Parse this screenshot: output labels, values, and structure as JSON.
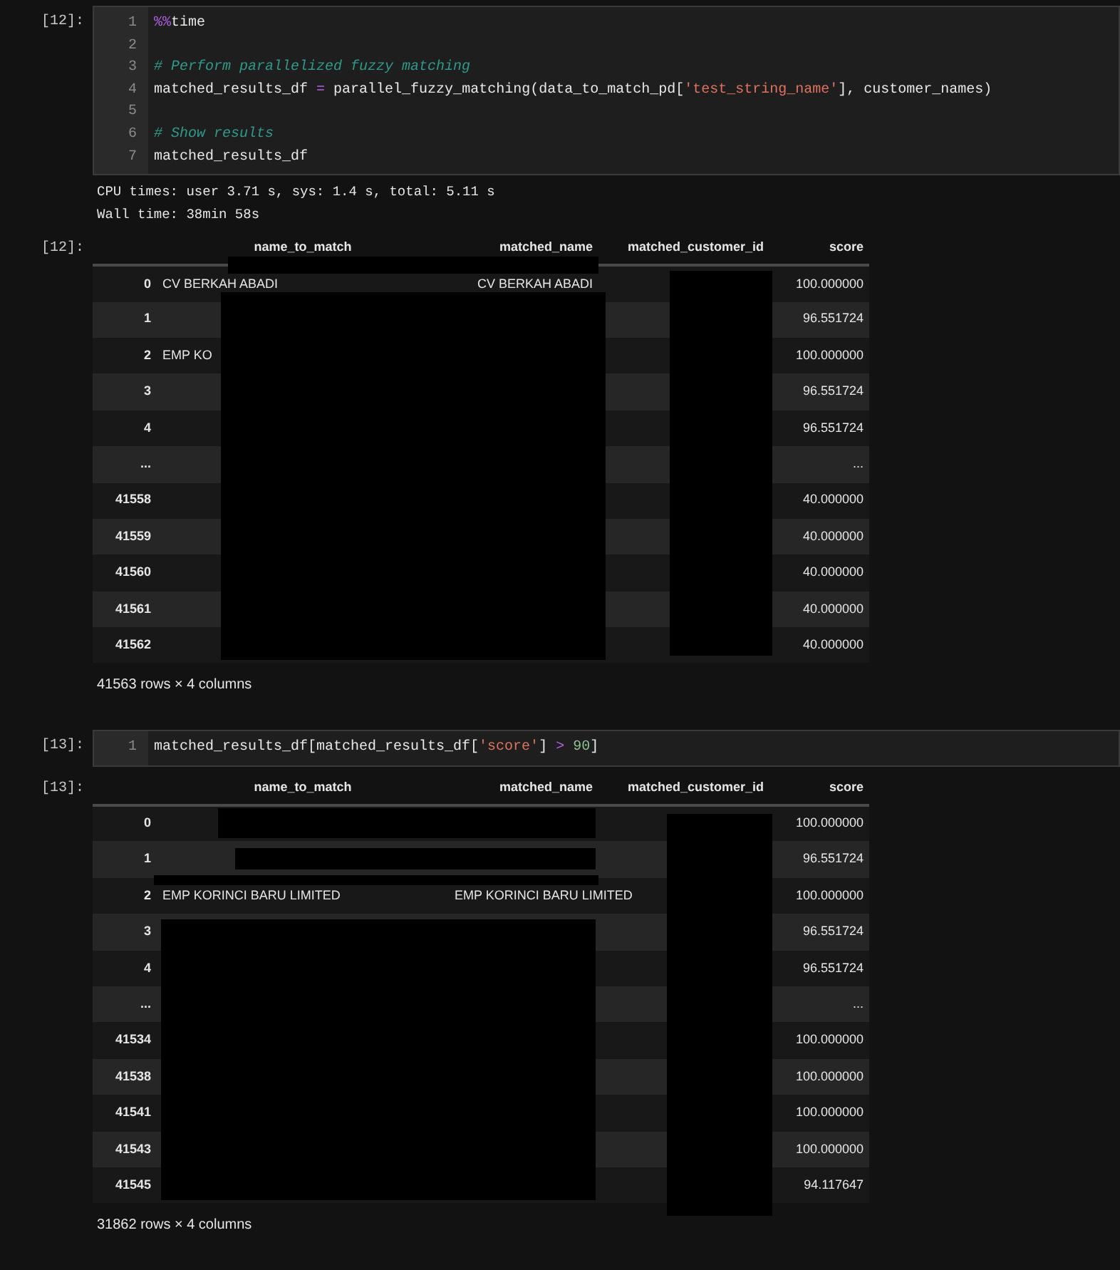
{
  "cells": [
    {
      "prompt": "[12]:",
      "code": [
        {
          "number": "1",
          "tokens": [
            {
              "kind": "magic",
              "text": "%%"
            },
            {
              "kind": "plain",
              "text": "time"
            }
          ]
        },
        {
          "number": "2"
        },
        {
          "number": "3",
          "tokens": [
            {
              "kind": "comment",
              "text": "# Perform parallelized fuzzy matching"
            }
          ]
        },
        {
          "number": "4",
          "tokens": [
            {
              "kind": "plain",
              "text": "matched_results_df "
            },
            {
              "kind": "operator",
              "text": "="
            },
            {
              "kind": "plain",
              "text": " parallel_fuzzy_matching(data_to_match_pd["
            },
            {
              "kind": "string",
              "text": "'test_string_name'"
            },
            {
              "kind": "plain",
              "text": "], customer_names)"
            }
          ]
        },
        {
          "number": "5"
        },
        {
          "number": "6",
          "tokens": [
            {
              "kind": "comment",
              "text": "# Show results"
            }
          ]
        },
        {
          "number": "7",
          "tokens": [
            {
              "kind": "plain",
              "text": "matched_results_df"
            }
          ]
        }
      ],
      "stdout": [
        "CPU times: user 3.71 s, sys: 1.4 s, total: 5.11 s",
        "Wall time: 38min 58s"
      ],
      "output_prompt": "[12]:",
      "table": {
        "columns": [
          "name_to_match",
          "matched_name",
          "matched_customer_id",
          "score"
        ],
        "rows": [
          {
            "index": "0",
            "name_to_match": "CV BERKAH ABADI",
            "matched_name": "CV BERKAH ABADI",
            "score": "100.000000"
          },
          {
            "index": "1",
            "score": "96.551724"
          },
          {
            "index": "2",
            "name_to_match": "EMP KO",
            "score": "100.000000"
          },
          {
            "index": "3",
            "score": "96.551724"
          },
          {
            "index": "4",
            "score": "96.551724"
          },
          {
            "index": "...",
            "score": "..."
          },
          {
            "index": "41558",
            "score": "40.000000"
          },
          {
            "index": "41559",
            "score": "40.000000"
          },
          {
            "index": "41560",
            "score": "40.000000"
          },
          {
            "index": "41561",
            "score": "40.000000"
          },
          {
            "index": "41562",
            "score": "40.000000"
          }
        ],
        "shape": "41563 rows × 4 columns"
      }
    },
    {
      "prompt": "[13]:",
      "code": [
        {
          "number": "1",
          "tokens": [
            {
              "kind": "plain",
              "text": "matched_results_df[matched_results_df["
            },
            {
              "kind": "string",
              "text": "'score'"
            },
            {
              "kind": "plain",
              "text": "] "
            },
            {
              "kind": "operator",
              "text": ">"
            },
            {
              "kind": "number",
              "text": " 90"
            },
            {
              "kind": "plain",
              "text": "]"
            }
          ]
        }
      ],
      "output_prompt": "[13]:",
      "table": {
        "columns": [
          "name_to_match",
          "matched_name",
          "matched_customer_id",
          "score"
        ],
        "rows": [
          {
            "index": "0",
            "score": "100.000000"
          },
          {
            "index": "1",
            "score": "96.551724"
          },
          {
            "index": "2",
            "name_to_match": "EMP KORINCI BARU LIMITED",
            "matched_name": "EMP KORINCI BARU LIMITED",
            "score": "100.000000"
          },
          {
            "index": "3",
            "score": "96.551724"
          },
          {
            "index": "4",
            "score": "96.551724"
          },
          {
            "index": "...",
            "score": "..."
          },
          {
            "index": "41534",
            "score": "100.000000"
          },
          {
            "index": "41538",
            "score": "100.000000"
          },
          {
            "index": "41541",
            "score": "100.000000"
          },
          {
            "index": "41543",
            "score": "100.000000"
          },
          {
            "index": "41545",
            "score": "94.117647"
          }
        ],
        "shape": "31862 rows × 4 columns"
      }
    }
  ]
}
